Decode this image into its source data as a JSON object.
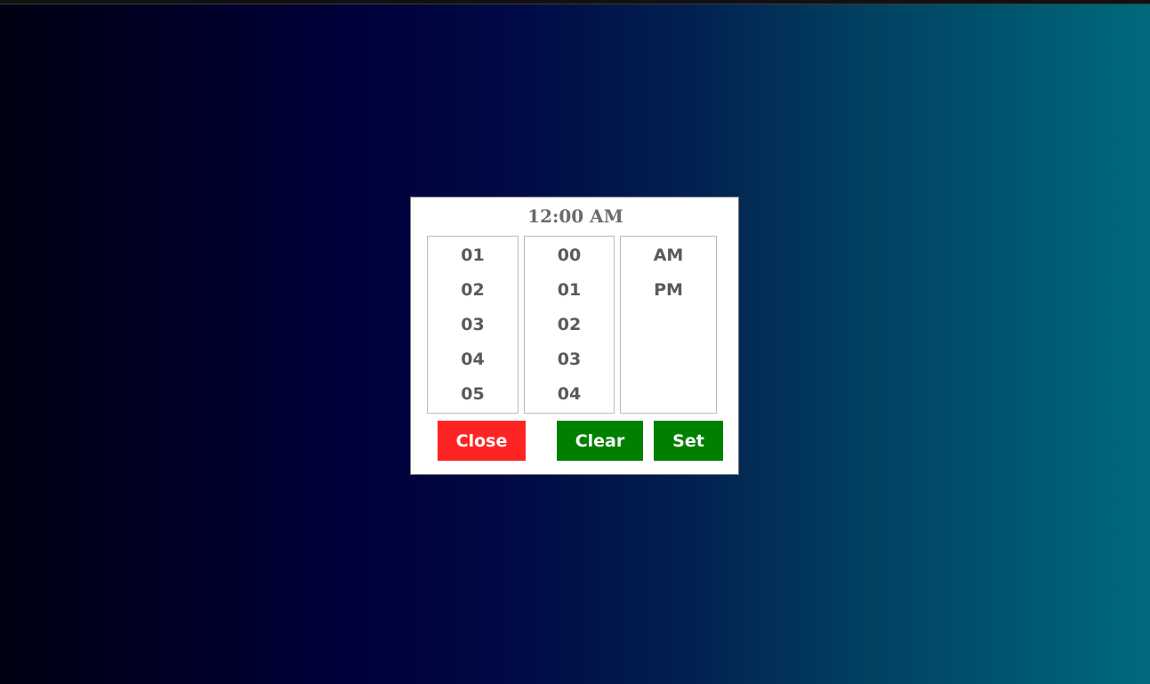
{
  "picker": {
    "title": "12:00 AM",
    "hours": [
      "01",
      "02",
      "03",
      "04",
      "05"
    ],
    "minutes": [
      "00",
      "01",
      "02",
      "03",
      "04"
    ],
    "periods": [
      "AM",
      "PM"
    ],
    "buttons": {
      "close": "Close",
      "clear": "Clear",
      "set": "Set"
    },
    "colors": {
      "close": "#ff2424",
      "clear": "#008000",
      "set": "#008000"
    }
  }
}
